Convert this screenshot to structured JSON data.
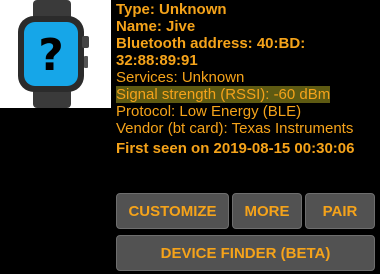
{
  "device": {
    "icon": "smartwatch-unknown-icon",
    "icon_mark": "?",
    "type": "Type: Unknown",
    "name": "Name: Jive",
    "bt_address": "Bluetooth address: 40:BD: 32:88:89:91",
    "services": "Services: Unknown",
    "signal": "Signal strength (RSSI): -60 dBm",
    "protocol": "Protocol: Low Energy (BLE)",
    "vendor": "Vendor (bt card): Texas Instruments",
    "first_seen": "First seen on 2019-08-15 00:30:06"
  },
  "actions": {
    "customize": "CUSTOMIZE",
    "more": "MORE",
    "pair": "PAIR",
    "device_finder": "DEVICE FINDER (BETA)"
  },
  "colors": {
    "accent": "#f5a31a",
    "highlight": "#5e5a12",
    "button": "#525252"
  }
}
